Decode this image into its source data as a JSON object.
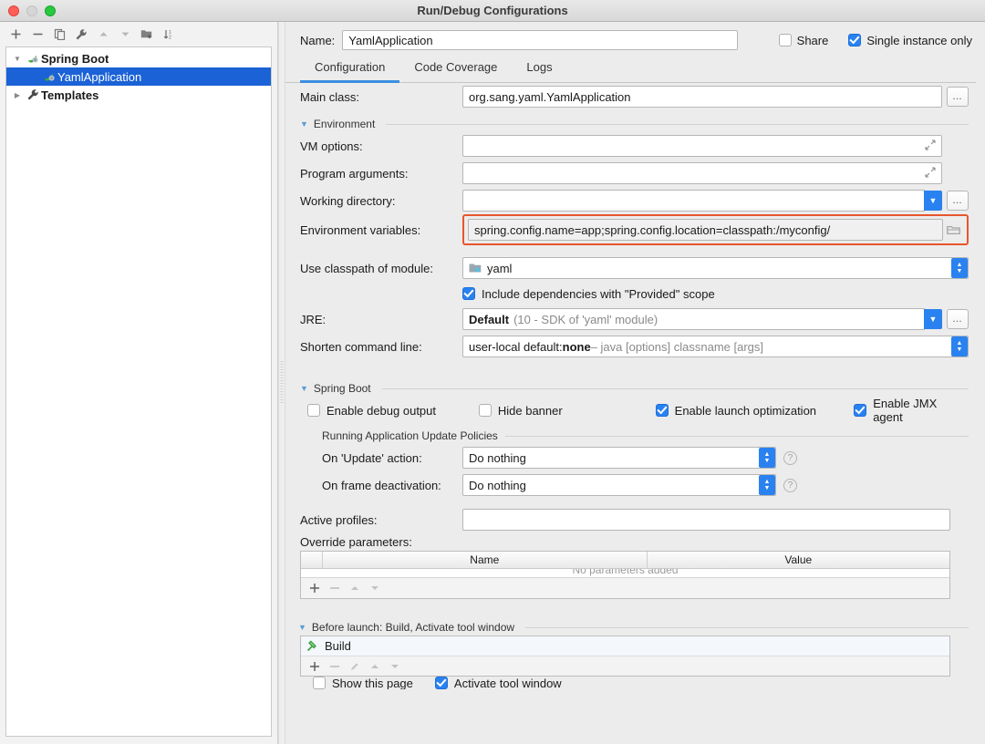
{
  "window": {
    "title": "Run/Debug Configurations",
    "traffic_lights": [
      "close-button",
      "minimize-button",
      "zoom-button"
    ]
  },
  "sidebar": {
    "toolbar": [
      {
        "name": "add-configuration-button",
        "glyph": "+"
      },
      {
        "name": "remove-configuration-button",
        "glyph": "−"
      },
      {
        "name": "copy-configuration-button",
        "glyph": "copy-icon"
      },
      {
        "name": "edit-templates-button",
        "glyph": "wrench-icon"
      },
      {
        "name": "move-up-button",
        "glyph": "triangle-up-icon"
      },
      {
        "name": "move-down-button",
        "glyph": "triangle-down-icon"
      },
      {
        "name": "create-folder-button",
        "glyph": "folder-add-icon"
      },
      {
        "name": "sort-configurations-button",
        "glyph": "sort-icon"
      }
    ],
    "tree": [
      {
        "label": "Spring Boot",
        "expanded": true,
        "selected": false,
        "depth": 0,
        "icon": "spring-boot-icon"
      },
      {
        "label": "YamlApplication",
        "expanded": null,
        "selected": true,
        "depth": 1,
        "icon": "spring-boot-icon"
      },
      {
        "label": "Templates",
        "expanded": false,
        "selected": false,
        "depth": 0,
        "icon": "wrench-icon"
      }
    ]
  },
  "header": {
    "name_label": "Name:",
    "name_value": "YamlApplication",
    "share_label": "Share",
    "share_checked": false,
    "single_instance_label": "Single instance only",
    "single_instance_checked": true
  },
  "tabs": [
    {
      "label": "Configuration",
      "active": true
    },
    {
      "label": "Code Coverage",
      "active": false
    },
    {
      "label": "Logs",
      "active": false
    }
  ],
  "form": {
    "main_class_label": "Main class:",
    "main_class_value": "org.sang.yaml.YamlApplication",
    "environment_section": "Environment",
    "vm_options_label": "VM options:",
    "vm_options_value": "",
    "program_arguments_label": "Program arguments:",
    "program_arguments_value": "",
    "working_directory_label": "Working directory:",
    "working_directory_value": "",
    "environment_variables_label": "Environment variables:",
    "environment_variables_value": "spring.config.name=app;spring.config.location=classpath:/myconfig/",
    "environment_variables_highlight_color": "#e8552d",
    "classpath_label": "Use classpath of module:",
    "classpath_value": "yaml",
    "include_provided_label": "Include dependencies with \"Provided\" scope",
    "include_provided_checked": true,
    "jre_label": "JRE:",
    "jre_value": "Default",
    "jre_value_hint": "(10 - SDK of 'yaml' module)",
    "shorten_label": "Shorten command line:",
    "shorten_value_prefix": "user-local default: ",
    "shorten_value_bold": "none",
    "shorten_value_hint": " – java [options] classname [args]"
  },
  "spring_boot": {
    "section_title": "Spring Boot",
    "checkboxes": [
      {
        "label": "Enable debug output",
        "checked": false
      },
      {
        "label": "Hide banner",
        "checked": false
      },
      {
        "label": "Enable launch optimization",
        "checked": true
      },
      {
        "label": "Enable JMX agent",
        "checked": true
      }
    ],
    "update_policies_title": "Running Application Update Policies",
    "on_update_label": "On 'Update' action:",
    "on_update_value": "Do nothing",
    "on_frame_label": "On frame deactivation:",
    "on_frame_value": "Do nothing",
    "active_profiles_label": "Active profiles:",
    "active_profiles_value": "",
    "override_parameters_label": "Override parameters:",
    "table_headers": [
      "",
      "Name",
      "Value"
    ],
    "table_empty_text": "No parameters added",
    "table_toolbar": [
      {
        "name": "add-parameter-button",
        "glyph": "+"
      },
      {
        "name": "remove-parameter-button",
        "glyph": "−"
      },
      {
        "name": "move-parameter-up-button",
        "glyph": "triangle-up-icon"
      },
      {
        "name": "move-parameter-down-button",
        "glyph": "triangle-down-icon"
      }
    ]
  },
  "before_launch": {
    "section_title": "Before launch: Build, Activate tool window",
    "items": [
      {
        "label": "Build",
        "icon": "hammer-icon"
      }
    ],
    "toolbar": [
      {
        "name": "add-task-button",
        "glyph": "+"
      },
      {
        "name": "remove-task-button",
        "glyph": "−"
      },
      {
        "name": "edit-task-button",
        "glyph": "pencil-icon"
      },
      {
        "name": "move-task-up-button",
        "glyph": "triangle-up-icon"
      },
      {
        "name": "move-task-down-button",
        "glyph": "triangle-down-icon"
      }
    ],
    "show_page_label": "Show this page",
    "show_page_checked": false,
    "activate_tool_window_label": "Activate tool window",
    "activate_tool_window_checked": true
  },
  "colors": {
    "accent_blue": "#2a82f0",
    "selection_blue": "#1a62d6",
    "highlight_red": "#e8552d",
    "tab_underline": "#3b8fe0",
    "spring_green": "#42a83c"
  }
}
